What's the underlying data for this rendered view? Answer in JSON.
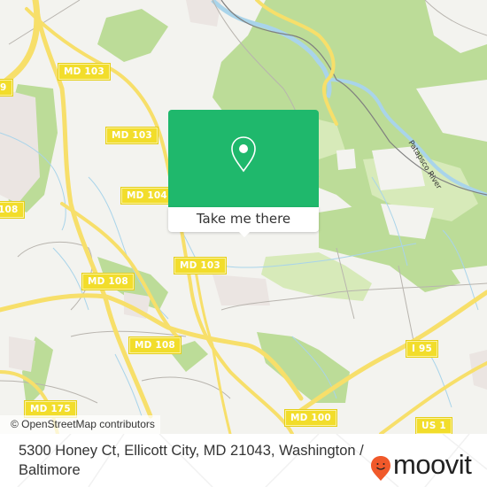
{
  "map": {
    "road_labels": [
      {
        "id": "md103-a",
        "text": "MD 103"
      },
      {
        "id": "md103-b",
        "text": "MD 103"
      },
      {
        "id": "md104",
        "text": "MD 104"
      },
      {
        "id": "md108-left",
        "text": "108"
      },
      {
        "id": "md103-c",
        "text": "MD 103"
      },
      {
        "id": "md108-a",
        "text": "MD 108"
      },
      {
        "id": "md108-b",
        "text": "MD 108"
      },
      {
        "id": "i95",
        "text": "I 95"
      },
      {
        "id": "md175",
        "text": "MD 175"
      },
      {
        "id": "md100",
        "text": "MD 100"
      },
      {
        "id": "us1",
        "text": "US 1"
      },
      {
        "id": "md99-partial",
        "text": "9"
      }
    ],
    "river_label": "Patapsco River",
    "attribution": "© OpenStreetMap contributors",
    "colors": {
      "background": "#f3f3ef",
      "forest": "#b9db95",
      "park": "#d4e9b5",
      "water": "#a9d4ea",
      "road": "#f7e06a",
      "residential": "#ece6e3"
    }
  },
  "popup": {
    "cta_label": "Take me there",
    "icon": "location-pin-icon",
    "color": "#1fb86c"
  },
  "footer": {
    "address": "5300 Honey Ct, Ellicott City, MD 21043, Washington / Baltimore",
    "logo_text": "moovit",
    "logo_color": "#f0592a"
  }
}
